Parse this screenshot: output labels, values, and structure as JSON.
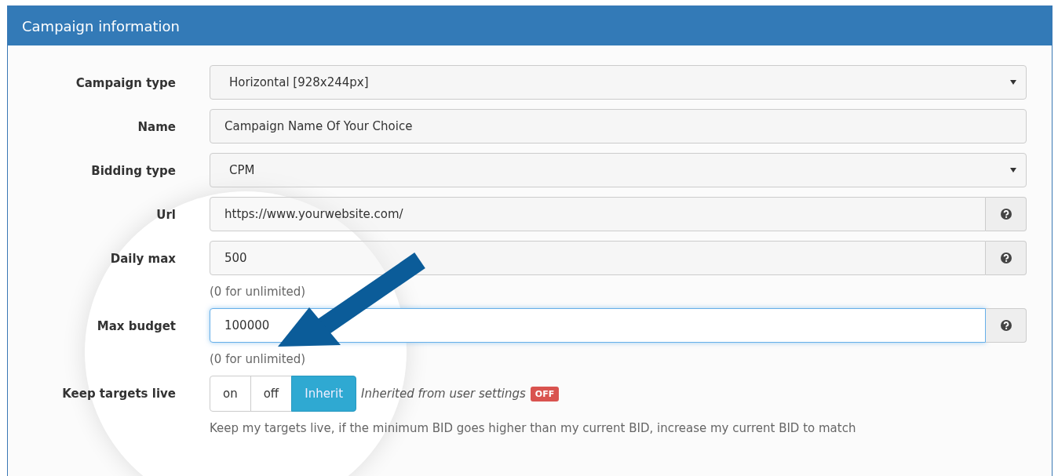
{
  "panel": {
    "title": "Campaign information"
  },
  "fields": [
    {
      "kind": "select",
      "label": "Campaign type",
      "value": "Horizontal [928x244px]"
    },
    {
      "kind": "text",
      "label": "Name",
      "value": "Campaign Name Of Your Choice"
    },
    {
      "kind": "select",
      "label": "Bidding type",
      "value": "CPM"
    },
    {
      "kind": "help",
      "label": "Url",
      "value": "https://www.yourwebsite.com/"
    },
    {
      "kind": "help",
      "label": "Daily max",
      "value": "500",
      "hint": "(0 for unlimited)"
    },
    {
      "kind": "help-focused",
      "label": "Max budget",
      "value": "100000",
      "hint": "(0 for unlimited)"
    }
  ],
  "keep_targets_live": {
    "label": "Keep targets live",
    "options": [
      {
        "label": "on",
        "selected": false
      },
      {
        "label": "off",
        "selected": false
      },
      {
        "label": "Inherit",
        "selected": true
      }
    ],
    "note": "Inherited from user settings",
    "badge": "OFF",
    "hint": "Keep my targets live, if the minimum BID goes higher than my current BID, increase my current BID to match"
  }
}
